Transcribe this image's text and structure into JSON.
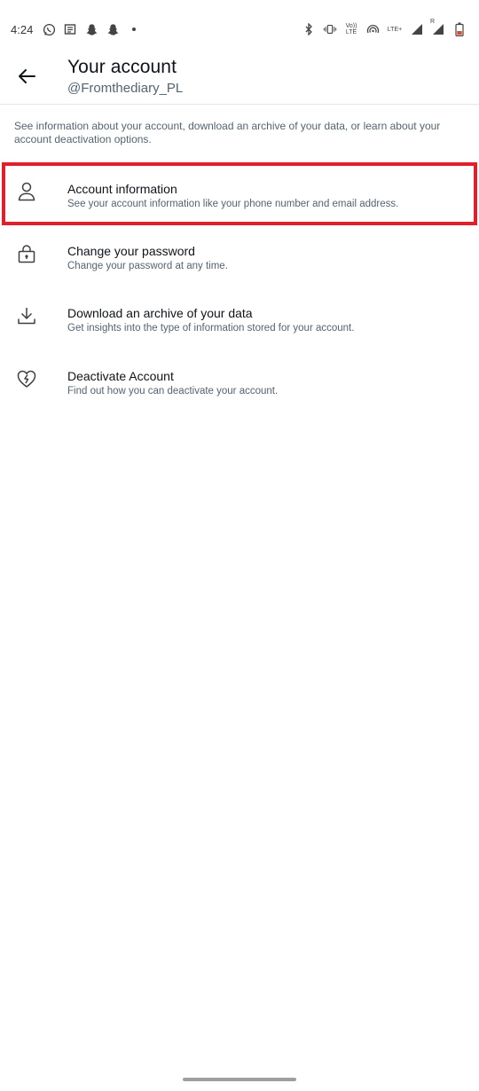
{
  "status_bar": {
    "time": "4:24",
    "icons_left": [
      "whatsapp-icon",
      "news-icon",
      "snapchat-icon",
      "snapchat-icon",
      "dot-icon"
    ],
    "volte_label": "Vo)) LTE",
    "lte_label": "LTE+",
    "roaming_label": "R"
  },
  "header": {
    "title": "Your account",
    "subtitle": "@Fromthediary_PL"
  },
  "description": "See information about your account, download an archive of your data, or learn about your account deactivation options.",
  "items": [
    {
      "icon": "person-icon",
      "title": "Account information",
      "desc": "See your account information like your phone number and email address."
    },
    {
      "icon": "lock-icon",
      "title": "Change your password",
      "desc": "Change your password at any time."
    },
    {
      "icon": "download-icon",
      "title": "Download an archive of your data",
      "desc": "Get insights into the type of information stored for your account."
    },
    {
      "icon": "broken-heart-icon",
      "title": "Deactivate Account",
      "desc": "Find out how you can deactivate your account."
    }
  ],
  "colors": {
    "highlight": "#e0202a",
    "primary_text": "#0f1419",
    "secondary_text": "#536471"
  }
}
